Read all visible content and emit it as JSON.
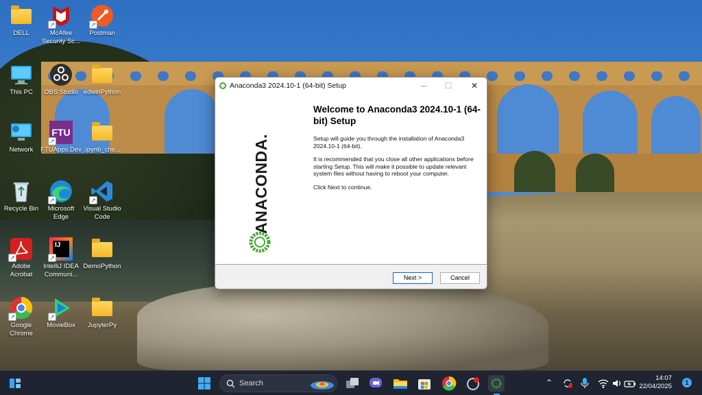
{
  "desktop": {
    "icons": [
      {
        "label": "DELL"
      },
      {
        "label": "McAfee Security Sc..."
      },
      {
        "label": "Postman"
      },
      {
        "label": "This PC"
      },
      {
        "label": "OBS Studio"
      },
      {
        "label": "edwinPython"
      },
      {
        "label": "Network"
      },
      {
        "label": "FTUApps.Dev"
      },
      {
        "label": ".ipynb_che..."
      },
      {
        "label": "Recycle Bin"
      },
      {
        "label": "Microsoft Edge"
      },
      {
        "label": "Visual Studio Code"
      },
      {
        "label": "Adobe Acrobat"
      },
      {
        "label": "IntelliJ IDEA Communi..."
      },
      {
        "label": "DemoPython"
      },
      {
        "label": "Google Chrome"
      },
      {
        "label": "MovieBox"
      },
      {
        "label": "JupyterPy"
      }
    ],
    "ftu_glyph": "FTU",
    "ij_glyph": "IJ"
  },
  "installer": {
    "title": "Anaconda3 2024.10-1 (64-bit) Setup",
    "logo_text": "ANACONDA.",
    "heading": "Welcome to Anaconda3 2024.10-1 (64-bit) Setup",
    "para1": "Setup will guide you through the installation of Anaconda3 2024.10-1 (64-bit).",
    "para2": "It is recommended that you close all other applications before starting Setup. This will make it possible to update relevant system files without having to reboot your computer.",
    "para3": "Click Next to continue.",
    "next_label": "Next >",
    "cancel_label": "Cancel",
    "close_glyph": "✕",
    "minimize_glyph": "—",
    "maximize_glyph": "☐"
  },
  "taskbar": {
    "search_placeholder": "Search",
    "time": "14:07",
    "date": "22/04/2025",
    "notification_count": "1"
  },
  "colors": {
    "anaconda_green": "#44a833",
    "accent_blue": "#0a64d8",
    "taskbar_bg": "#1f2430"
  }
}
